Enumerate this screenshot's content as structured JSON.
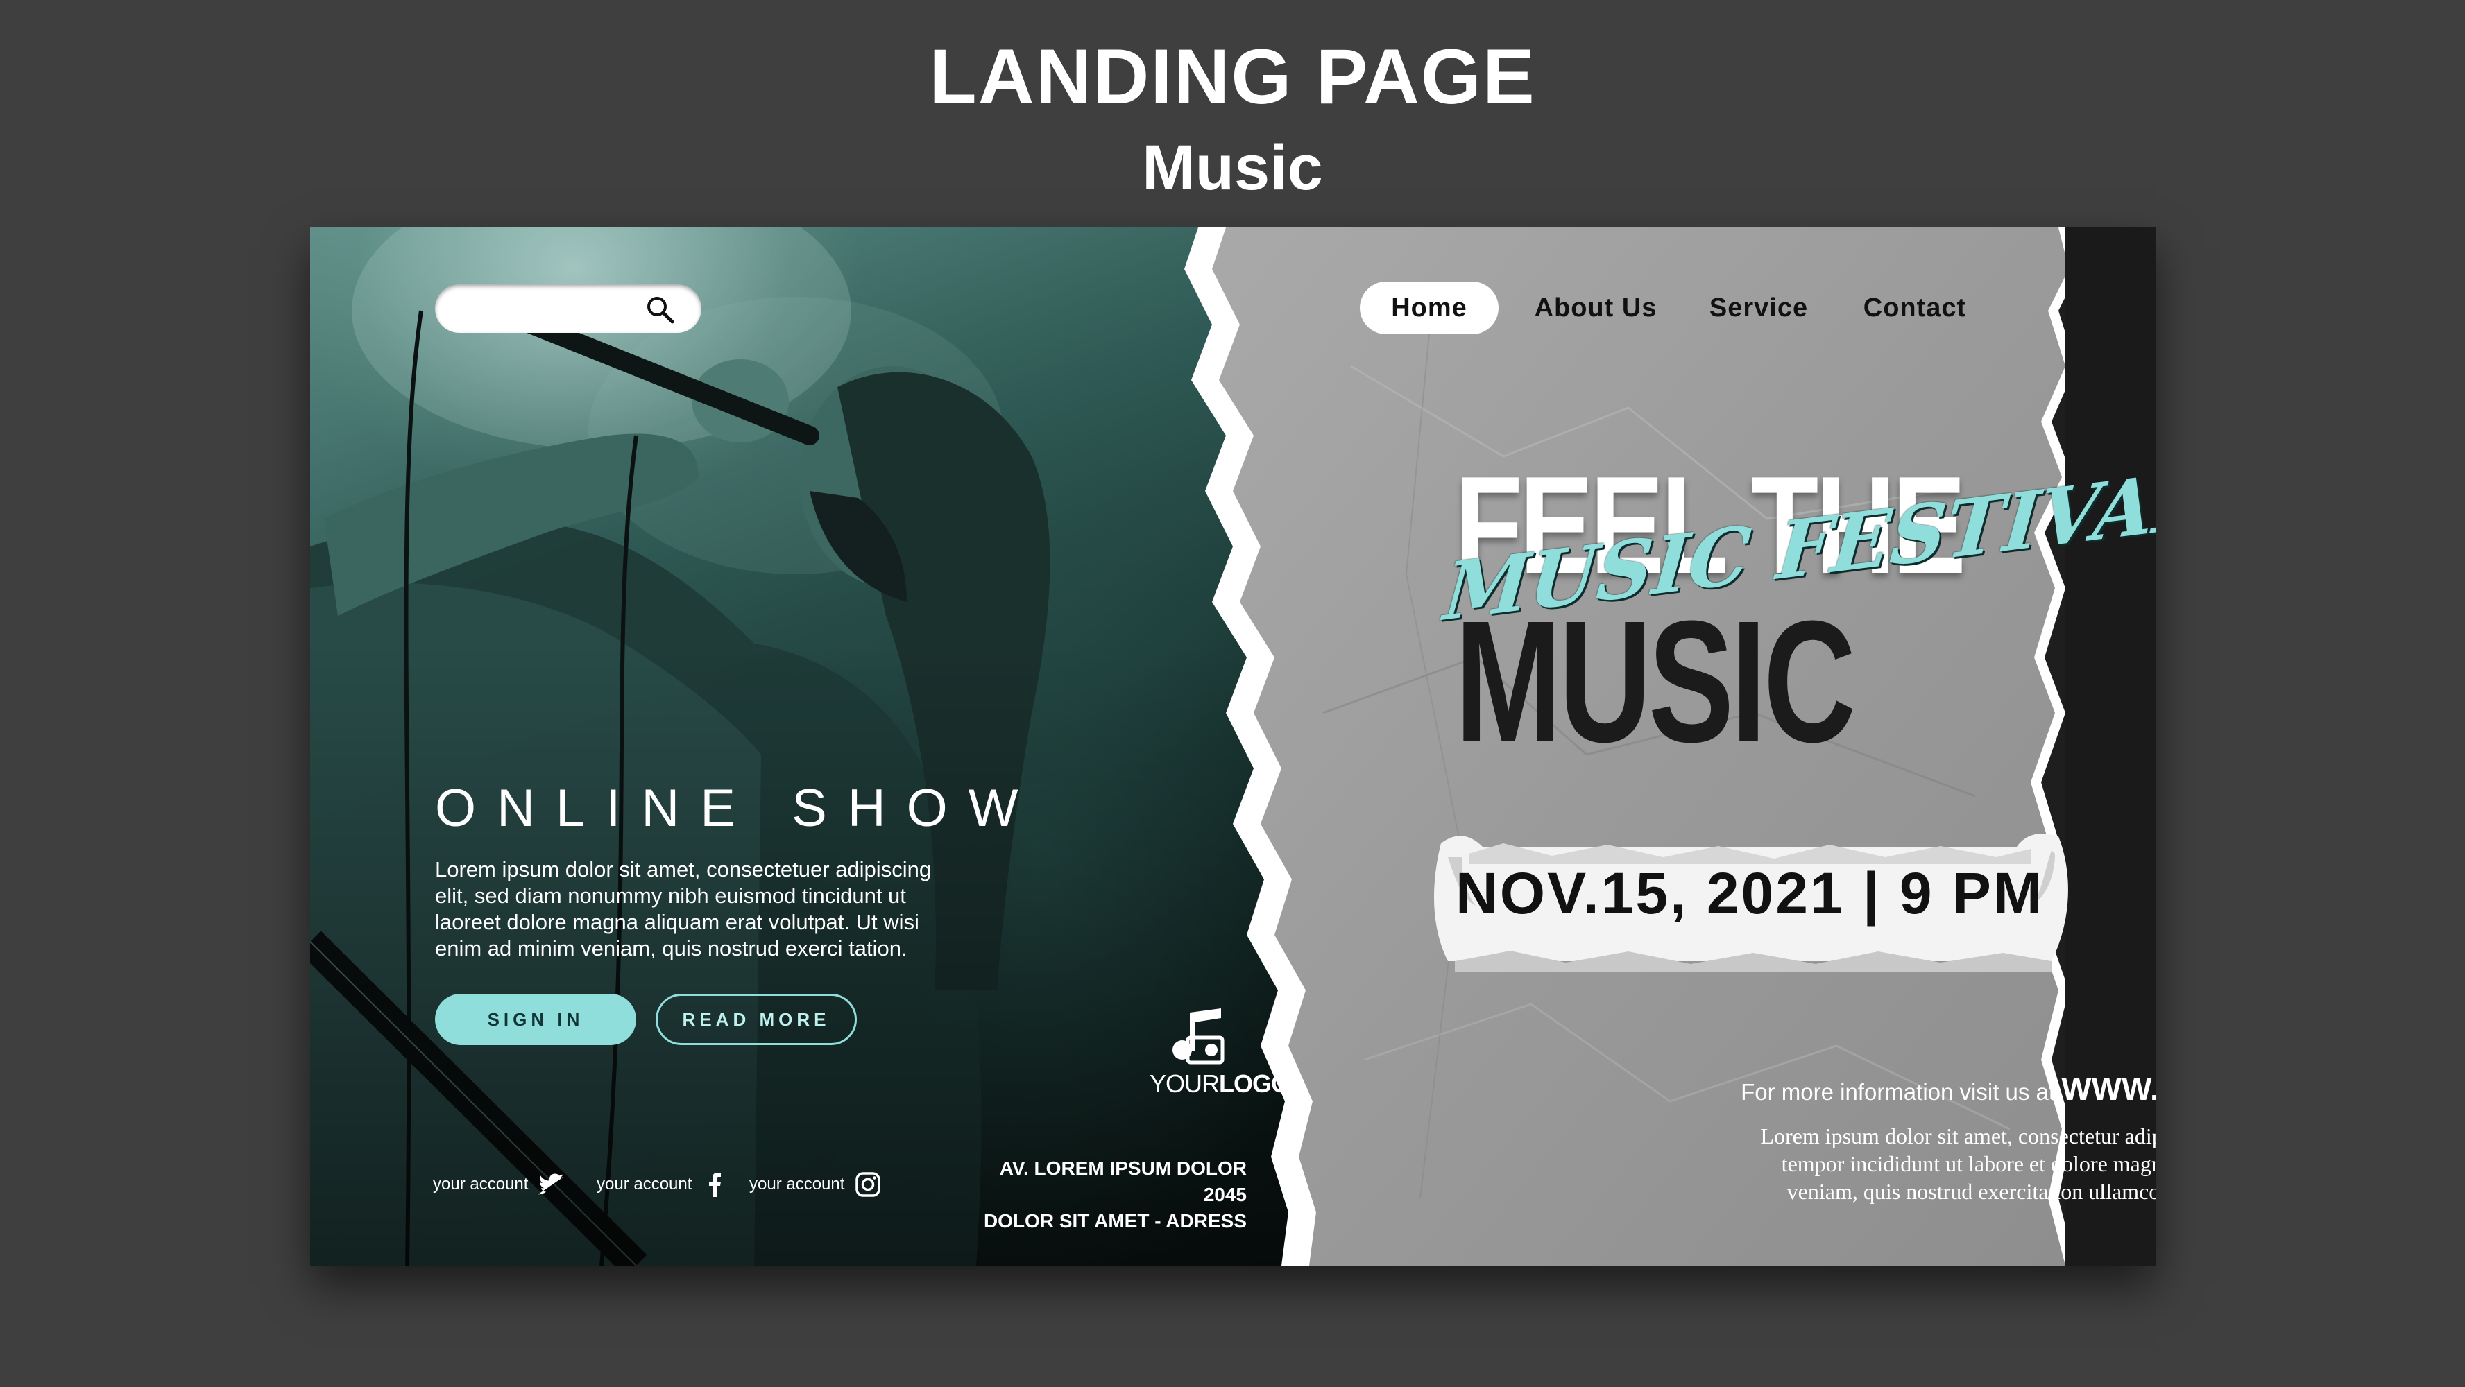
{
  "heading": "LANDING PAGE",
  "subheading": "Music",
  "search": {
    "placeholder": ""
  },
  "nav": {
    "items": [
      {
        "label": "Home",
        "active": true
      },
      {
        "label": "About Us",
        "active": false
      },
      {
        "label": "Service",
        "active": false
      },
      {
        "label": "Contact",
        "active": false
      }
    ]
  },
  "hero_left": {
    "title": "ONLINE SHOW",
    "body": "Lorem ipsum dolor sit amet, consectetuer adipiscing elit, sed diam nonummy nibh euismod tincidunt ut laoreet dolore magna aliquam erat volutpat. Ut wisi enim ad minim veniam, quis nostrud exerci tation.",
    "sign_in_label": "SIGN IN",
    "read_more_label": "READ MORE"
  },
  "logo": {
    "text_part1": "YOUR",
    "text_part2": "LOGO",
    "icon": "music-note-icon"
  },
  "socials": [
    {
      "label": "your account",
      "icon": "twitter-icon"
    },
    {
      "label": "your account",
      "icon": "facebook-icon"
    },
    {
      "label": "your account",
      "icon": "instagram-icon"
    }
  ],
  "address": {
    "line1": "AV. LOREM IPSUM DOLOR 2045",
    "line2": "DOLOR SIT AMET - ADRESS"
  },
  "hero_right": {
    "line1": "FEEL THE",
    "line2": "MUSIC",
    "script": "MUSIC FESTIVAL",
    "date": "NOV.15, 2021 | 9 PM",
    "more_info_prefix": "For more information visit us at",
    "site": "WWW.YOURSITE.COM",
    "body_line1": "Lorem ipsum dolor sit amet, consectetur adipisicing elit, sed do eiusmod",
    "body_line2": "tempor incididunt ut labore et dolore magna aliqua. Ut enim ad minim",
    "body_line3": "veniam, quis nostrud exercitation ullamco laboris nisi ut aliquip ex ea"
  },
  "colors": {
    "page_background": "#3f3f3f",
    "accent_teal": "#8fdedb",
    "paper_gray": "#9b9b9b",
    "dark_text": "#111111"
  }
}
